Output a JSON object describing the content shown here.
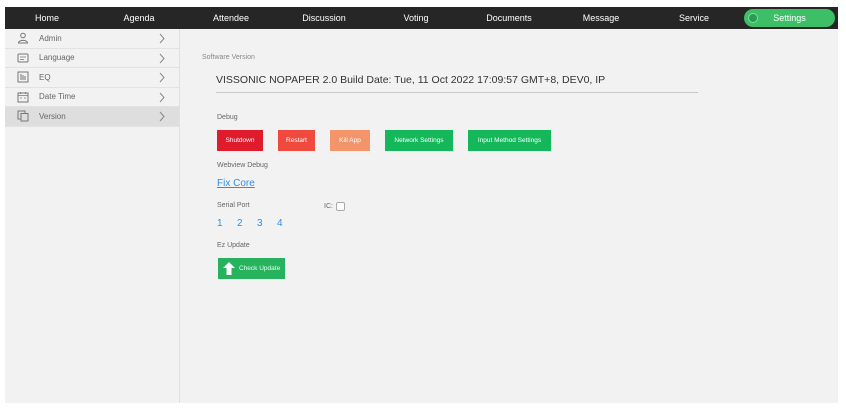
{
  "nav": {
    "items": [
      {
        "label": "Home"
      },
      {
        "label": "Agenda"
      },
      {
        "label": "Attendee"
      },
      {
        "label": "Discussion"
      },
      {
        "label": "Voting"
      },
      {
        "label": "Documents"
      },
      {
        "label": "Message"
      },
      {
        "label": "Service"
      }
    ],
    "active": {
      "label": "Settings",
      "icon": "settings-icon"
    }
  },
  "sidebar": {
    "items": [
      {
        "label": "Admin",
        "icon": "user-icon"
      },
      {
        "label": "Language",
        "icon": "language-icon"
      },
      {
        "label": "EQ",
        "icon": "equalizer-icon"
      },
      {
        "label": "Date Time",
        "icon": "calendar-icon"
      },
      {
        "label": "Version",
        "icon": "copy-icon"
      }
    ],
    "selected": "Version"
  },
  "main": {
    "software_version_label": "Software Version",
    "version_text": "VISSONIC NOPAPER 2.0 Build Date: Tue, 11 Oct 2022 17:09:57 GMT+8, DEV0, IP",
    "debug_label": "Debug",
    "buttons": [
      {
        "label": "Shutdown",
        "color": "#e01b2c"
      },
      {
        "label": "Restart",
        "color": "#f04a3e"
      },
      {
        "label": "Kill App",
        "color": "#f4946a"
      },
      {
        "label": "Network Settings",
        "color": "#14b85a"
      },
      {
        "label": "Input Method Settings",
        "color": "#14b85a"
      }
    ],
    "webview_debug_label": "Webview Debug",
    "fix_core_link": "Fix Core",
    "serial_port_label": "Serial Port",
    "ic_label": "IC:",
    "ports": [
      "1",
      "2",
      "3",
      "4"
    ],
    "ez_update_label": "Ez Update",
    "check_update_label": "Check Update"
  },
  "colors": {
    "nav_bg": "#262626",
    "accent_green": "#3dbf68",
    "link_blue": "#2f8fe0"
  }
}
